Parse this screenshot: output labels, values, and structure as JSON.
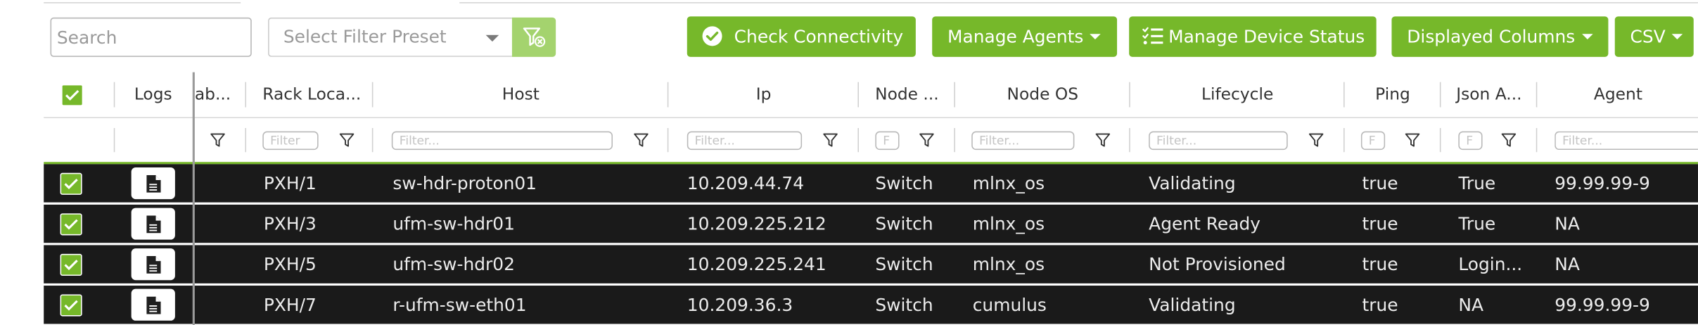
{
  "toolbar": {
    "search_placeholder": "Search",
    "filter_preset_placeholder": "Select Filter Preset",
    "check_connectivity": "Check Connectivity",
    "manage_agents": "Manage Agents",
    "manage_device_status": "Manage Device Status",
    "displayed_columns": "Displayed Columns",
    "csv": "CSV"
  },
  "columns": {
    "logs": "Logs",
    "label": "ab...",
    "rack_location": "Rack Loca...",
    "host": "Host",
    "ip": "Ip",
    "node_type": "Node ...",
    "node_os": "Node OS",
    "lifecycle": "Lifecycle",
    "ping": "Ping",
    "json_api": "Json A...",
    "agent": "Agent"
  },
  "filters": {
    "text_placeholder": "Filter...",
    "short_placeholder": "Filter",
    "mini_placeholder": "F"
  },
  "rows": [
    {
      "rack": "PXH/1",
      "host": "sw-hdr-proton01",
      "ip": "10.209.44.74",
      "type": "Switch",
      "os": "mlnx_os",
      "lifecycle": "Validating",
      "ping": "true",
      "json": "True",
      "agent": "99.99.99-9"
    },
    {
      "rack": "PXH/3",
      "host": "ufm-sw-hdr01",
      "ip": "10.209.225.212",
      "type": "Switch",
      "os": "mlnx_os",
      "lifecycle": "Agent Ready",
      "ping": "true",
      "json": "True",
      "agent": "NA"
    },
    {
      "rack": "PXH/5",
      "host": "ufm-sw-hdr02",
      "ip": "10.209.225.241",
      "type": "Switch",
      "os": "mlnx_os",
      "lifecycle": "Not Provisioned",
      "ping": "true",
      "json": "Login...",
      "agent": "NA"
    },
    {
      "rack": "PXH/7",
      "host": "r-ufm-sw-eth01",
      "ip": "10.209.36.3",
      "type": "Switch",
      "os": "cumulus",
      "lifecycle": "Validating",
      "ping": "true",
      "json": "NA",
      "agent": "99.99.99-9"
    }
  ],
  "icons": {
    "check_connectivity": "check-circle-icon",
    "manage_device_status": "checklist-icon",
    "preset_clear": "filter-remove-icon",
    "column_filter": "filter-icon",
    "row_logs": "document-icon",
    "row_select": "checkbox-checked-icon"
  },
  "colors": {
    "accent": "#76b82a",
    "accent_light": "#a4d36e",
    "row_background": "#1a1a1a",
    "row_text": "#ececec"
  }
}
